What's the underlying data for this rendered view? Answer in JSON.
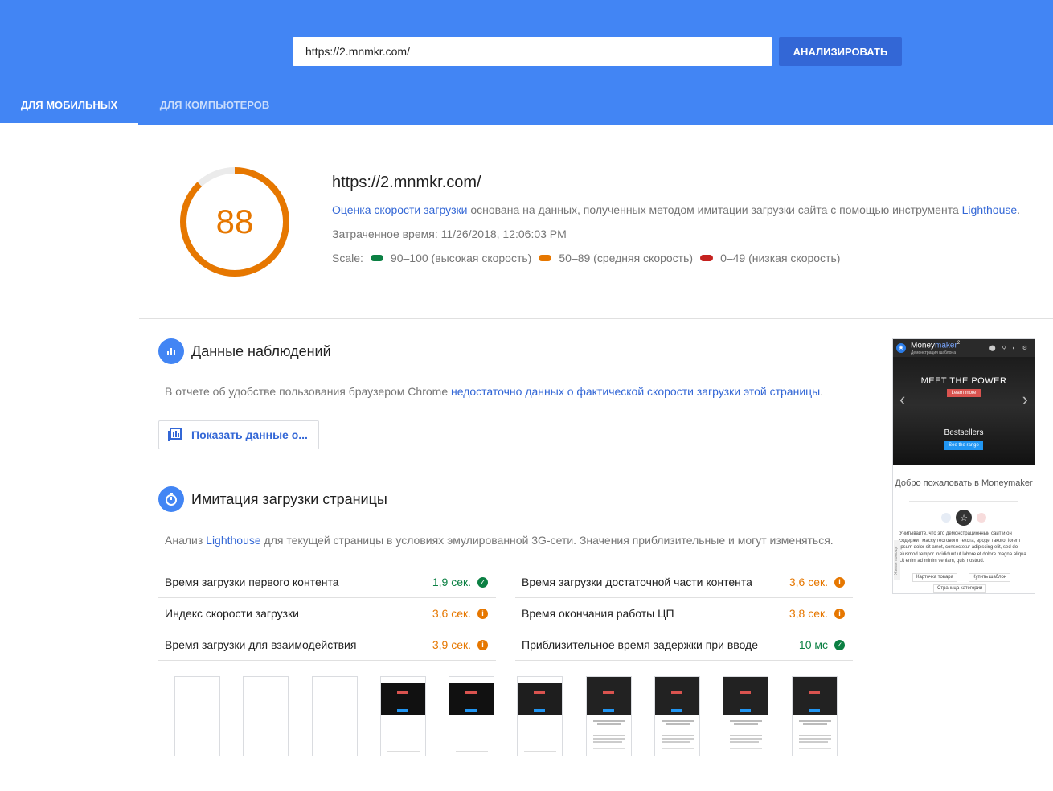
{
  "header": {
    "url_value": "https://2.mnmkr.com/",
    "analyze_label": "АНАЛИЗИРОВАТЬ",
    "tabs": [
      {
        "label": "ДЛЯ МОБИЛЬНЫХ",
        "active": true
      },
      {
        "label": "ДЛЯ КОМПЬЮТЕРОВ",
        "active": false
      }
    ]
  },
  "summary": {
    "score": "88",
    "score_fraction": 0.88,
    "url": "https://2.mnmkr.com/",
    "desc_link": "Оценка скорости загрузки",
    "desc_middle": " основана на данных, полученных методом имитации загрузки сайта с помощью инструмента ",
    "desc_link2": "Lighthouse",
    "desc_end": ".",
    "time": "Затраченное время: 11/26/2018, 12:06:03 PM",
    "scale_label": "Scale:",
    "scale": [
      {
        "label": "90–100 (высокая скорость)",
        "color": "#0b8043"
      },
      {
        "label": "50–89 (средняя скорость)",
        "color": "#e67700"
      },
      {
        "label": "0–49 (низкая скорость)",
        "color": "#c5221f"
      }
    ]
  },
  "field_data": {
    "title": "Данные наблюдений",
    "text_start": "В отчете об удобстве пользования браузером Chrome ",
    "text_link": "недостаточно данных о фактической скорости загрузки этой страницы",
    "text_end": ".",
    "button_label": "Показать данные о..."
  },
  "lab_data": {
    "title": "Имитация загрузки страницы",
    "text_start": "Анализ ",
    "text_link": "Lighthouse",
    "text_end": " для текущей страницы в условиях эмулированной 3G-сети. Значения приблизительные и могут изменяться.",
    "metrics": [
      {
        "name": "Время загрузки первого контента",
        "value": "1,9 сек.",
        "status": "good"
      },
      {
        "name": "Время загрузки достаточной части контента",
        "value": "3,6 сек.",
        "status": "average"
      },
      {
        "name": "Индекс скорости загрузки",
        "value": "3,6 сек.",
        "status": "average"
      },
      {
        "name": "Время окончания работы ЦП",
        "value": "3,8 сек.",
        "status": "average"
      },
      {
        "name": "Время загрузки для взаимодействия",
        "value": "3,9 сек.",
        "status": "average"
      },
      {
        "name": "Приблизительное время задержки при вводе",
        "value": "10 мс",
        "status": "good"
      }
    ]
  },
  "preview": {
    "brand_a": "Money",
    "brand_b": "maker",
    "brand_sup": "2",
    "brand_sub": "Демонстрация шаблона",
    "hero_title": "MEET THE POWER",
    "hero_button": "Learn more",
    "bestsellers": "Bestsellers",
    "range_button": "See the range",
    "welcome": "Добро пожаловать в Moneymaker",
    "paragraph": "Учитывайте, что это демонстрационный сайт и он содержит массу тестового текста, вроде такого: lorem ipsum dolor sit amet, consectetur adipiscing elit, sed do eiusmod tempor incididunt ut labore et dolore magna aliqua. Ut enim ad minim veniam, quis nostrud.",
    "btn_product": "Карточка товара",
    "btn_buy": "Купить шаблон",
    "btn_category": "Страница категории",
    "side_tab": "Живая помощь"
  }
}
